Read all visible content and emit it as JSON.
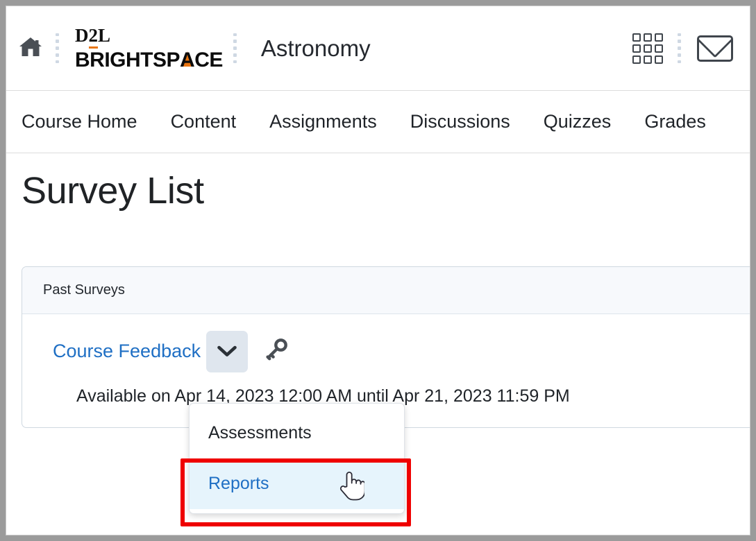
{
  "window": {
    "frame_border_color": "#c9c9c9",
    "backdrop_color": "#9b9b9b"
  },
  "header": {
    "home_icon": "home-icon",
    "brand": {
      "line1": "D2L",
      "line1_accent_char": "2",
      "line2_before": "BRIGHTSP",
      "line2_accent_char": "A",
      "line2_after": "CE",
      "accent_color": "#e87511"
    },
    "course_title": "Astronomy",
    "waffle_icon": "apps-grid-icon",
    "message_icon": "envelope-icon",
    "separator_icon": "vertical-dots-separator"
  },
  "course_nav": {
    "items": [
      {
        "label": "Course Home"
      },
      {
        "label": "Content"
      },
      {
        "label": "Assignments"
      },
      {
        "label": "Discussions"
      },
      {
        "label": "Quizzes"
      },
      {
        "label": "Grades"
      }
    ]
  },
  "main": {
    "page_title": "Survey List",
    "card": {
      "header_label": "Past Surveys",
      "survey": {
        "name": "Course Feedback",
        "link_color": "#1f6fc4",
        "dropdown_icon": "chevron-down-icon",
        "permissions_icon": "key-icon",
        "availability_text": "Available on Apr 14, 2023 12:00 AM until Apr 21, 2023 11:59 PM"
      }
    }
  },
  "dropdown": {
    "items": [
      {
        "label": "Assessments",
        "selected": false
      },
      {
        "label": "Reports",
        "selected": true
      }
    ],
    "highlight_color": "#e6f4fc",
    "highlight_text_color": "#1f6fc4"
  },
  "annotation": {
    "type": "rectangle",
    "color": "#ef0000",
    "targets": "Reports"
  },
  "cursor": {
    "type": "pointing-hand"
  }
}
